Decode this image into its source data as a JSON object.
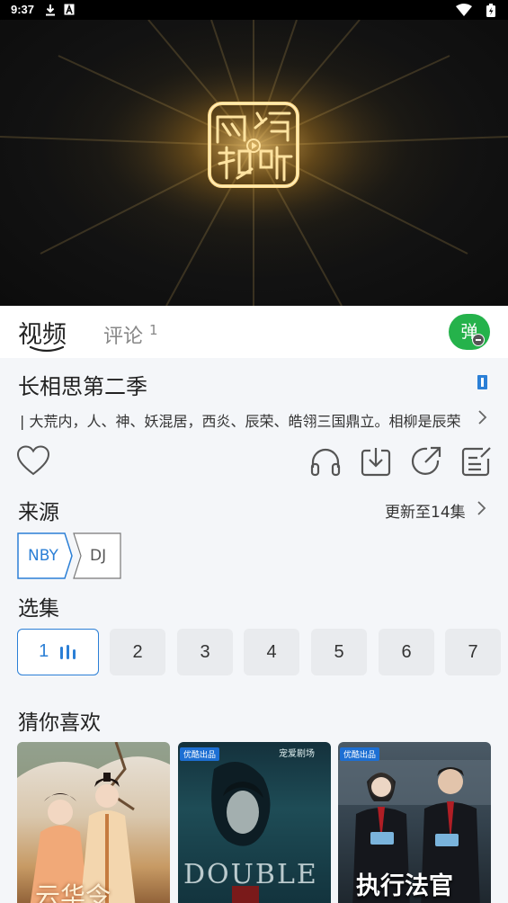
{
  "status_bar": {
    "time": "9:37",
    "icons": [
      "download-icon",
      "font-a-icon",
      "wifi-icon",
      "battery-charging-icon"
    ]
  },
  "player": {
    "logo_text": [
      "网",
      "络",
      "视",
      "听"
    ]
  },
  "tabs": {
    "video_label": "视频",
    "comment_label": "评论",
    "comment_count": "1",
    "danmu_label": "弹"
  },
  "show": {
    "title": "长相思第二季",
    "description": "| 大荒内，人、神、妖混居，西炎、辰荣、皓翎三国鼎立。相柳是辰荣义军军师"
  },
  "actions": [
    "favorite-heart-icon",
    "headphones-icon",
    "download-icon",
    "share-icon",
    "edit-note-icon"
  ],
  "source": {
    "section_title": "来源",
    "update_text": "更新至14集",
    "options": [
      "NBY",
      "DJ"
    ],
    "selected": "NBY"
  },
  "episodes": {
    "section_title": "选集",
    "items": [
      "1",
      "2",
      "3",
      "4",
      "5",
      "6",
      "7"
    ],
    "selected": "1"
  },
  "recommend": {
    "section_title": "猜你喜欢",
    "items": [
      {
        "badge": "",
        "poster_text": "云华令",
        "kind": "costume"
      },
      {
        "badge": "优酷出品",
        "poster_text": "DOUBLE",
        "kind": "dark"
      },
      {
        "badge": "优酷出品",
        "poster_text": "执行法官",
        "kind": "court"
      }
    ]
  },
  "colors": {
    "accent": "#2b7fd6",
    "danmu_green": "#25b24b",
    "background": "#f4f6f9"
  }
}
